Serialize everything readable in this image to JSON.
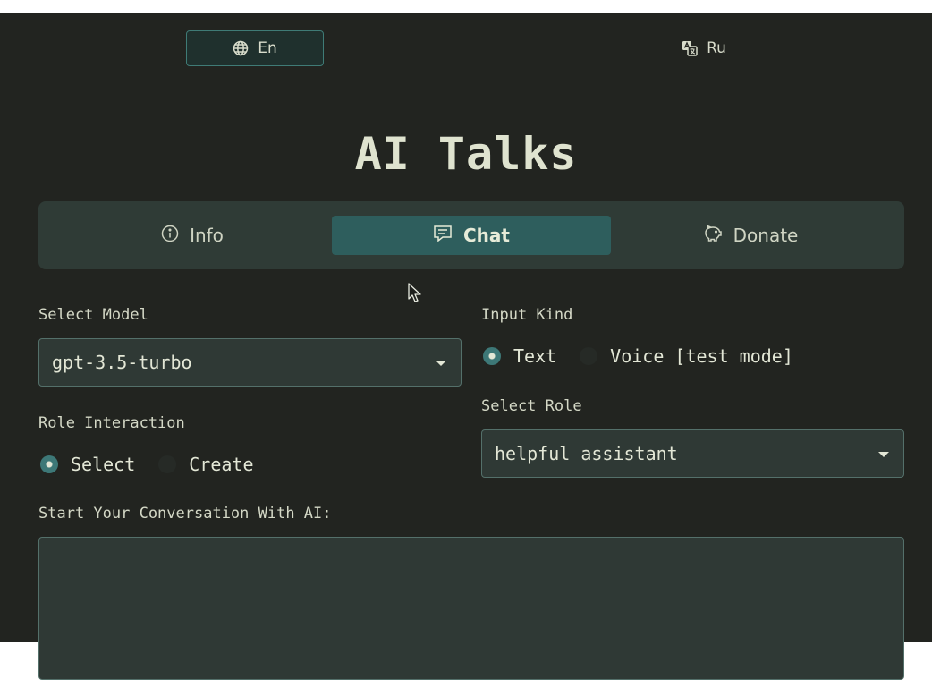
{
  "language": {
    "en_label": "En",
    "ru_label": "Ru",
    "en_icon": "globe-icon",
    "ru_icon": "translate-icon"
  },
  "title": "AI Talks",
  "tabs": [
    {
      "label": "Info",
      "icon": "info-icon"
    },
    {
      "label": "Chat",
      "icon": "chat-icon",
      "active": true
    },
    {
      "label": "Donate",
      "icon": "piggy-bank-icon"
    }
  ],
  "model": {
    "label": "Select Model",
    "value": "gpt-3.5-turbo"
  },
  "input_kind": {
    "label": "Input Kind",
    "options": [
      "Text",
      "Voice [test mode]"
    ],
    "selected": "Text"
  },
  "role_interaction": {
    "label": "Role Interaction",
    "options": [
      "Select",
      "Create"
    ],
    "selected": "Select"
  },
  "role": {
    "label": "Select Role",
    "value": "helpful assistant"
  },
  "conversation": {
    "label": "Start Your Conversation With AI:",
    "value": ""
  },
  "colors": {
    "background": "#222420",
    "accent": "#2e5e5d",
    "text": "#dfe3cf"
  }
}
